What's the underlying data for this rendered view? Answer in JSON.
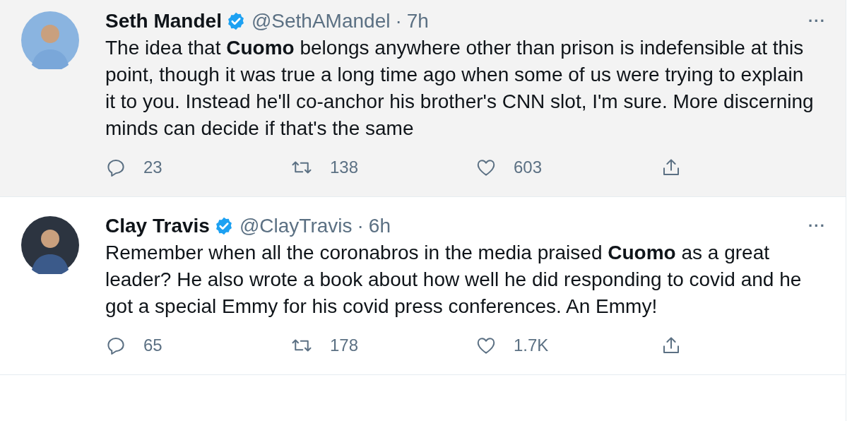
{
  "tweets": [
    {
      "name": "Seth Mandel",
      "verified": true,
      "handle": "@SethAMandel",
      "separator": "·",
      "time": "7h",
      "highlighted": true,
      "text": "The idea that **Cuomo** belongs anywhere other than prison is indefensible at this point, though it was true a long time ago when some of us were trying to explain it to you. Instead he'll co-anchor his brother's CNN slot, I'm sure. More discerning minds can decide if that's the same",
      "more": "···",
      "replies": "23",
      "retweets": "138",
      "likes": "603"
    },
    {
      "name": "Clay Travis",
      "verified": true,
      "handle": "@ClayTravis",
      "separator": "·",
      "time": "6h",
      "highlighted": false,
      "text": "Remember when all the coronabros in the media praised **Cuomo** as a great leader? He also wrote a book about how well he did responding to covid and he got a special Emmy for his covid press conferences. An Emmy!",
      "more": "···",
      "replies": "65",
      "retweets": "178",
      "likes": "1.7K"
    }
  ]
}
